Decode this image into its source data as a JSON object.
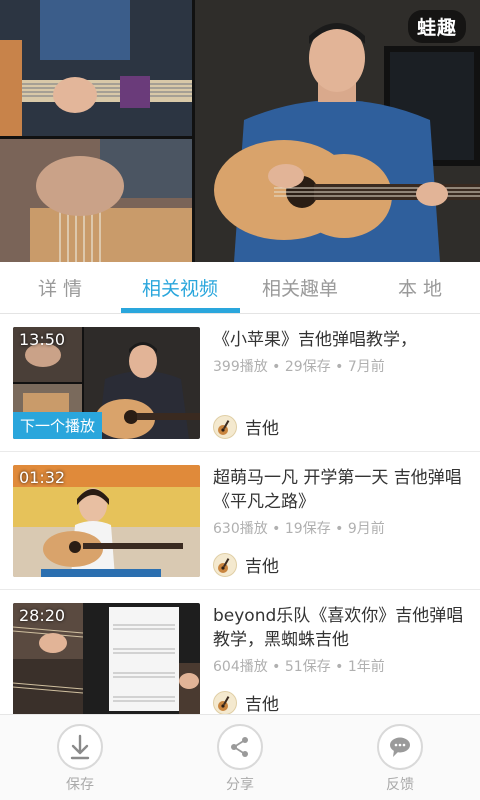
{
  "player": {
    "watermark": "蛙趣"
  },
  "tabs": [
    {
      "label": "详 情",
      "active": false
    },
    {
      "label": "相关视频",
      "active": true
    },
    {
      "label": "相关趣单",
      "active": false
    },
    {
      "label": "本 地",
      "active": false
    }
  ],
  "accent_color": "#2aa6dc",
  "videos": [
    {
      "duration": "13:50",
      "badge": "下一个播放",
      "title": "《小苹果》吉他弹唱教学，",
      "meta": "399播放 • 29保存 • 7月前",
      "author": "吉他"
    },
    {
      "duration": "01:32",
      "title": "超萌马一凡 开学第一天 吉他弹唱《平凡之路》",
      "meta": "630播放 • 19保存 • 9月前",
      "author": "吉他"
    },
    {
      "duration": "28:20",
      "title": "beyond乐队《喜欢你》吉他弹唱教学，黑蜘蛛吉他",
      "meta": "604播放 • 51保存 • 1年前",
      "author": "吉他"
    }
  ],
  "toolbar": {
    "save": {
      "label": "保存",
      "icon": "download-icon"
    },
    "share": {
      "label": "分享",
      "icon": "share-icon"
    },
    "feedback": {
      "label": "反馈",
      "icon": "comment-icon"
    }
  }
}
